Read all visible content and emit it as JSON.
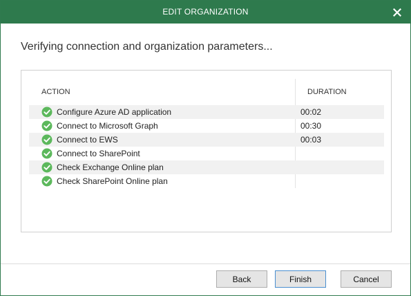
{
  "window": {
    "title": "EDIT ORGANIZATION",
    "close_icon": "close-icon",
    "accent": "#2e7a4d"
  },
  "heading": "Verifying connection and organization parameters...",
  "table": {
    "columns": [
      "ACTION",
      "DURATION"
    ],
    "rows": [
      {
        "action": "Configure Azure AD application",
        "duration": "00:02",
        "status": "success"
      },
      {
        "action": "Connect to Microsoft Graph",
        "duration": "00:30",
        "status": "success"
      },
      {
        "action": "Connect to EWS",
        "duration": "00:03",
        "status": "success"
      },
      {
        "action": "Connect to SharePoint",
        "duration": "",
        "status": "success"
      },
      {
        "action": "Check Exchange Online plan",
        "duration": "",
        "status": "success"
      },
      {
        "action": "Check SharePoint Online plan",
        "duration": "",
        "status": "success"
      }
    ],
    "status_icon": "check-circle-icon",
    "success_color": "#5cb85c"
  },
  "buttons": {
    "back": "Back",
    "finish": "Finish",
    "cancel": "Cancel"
  }
}
